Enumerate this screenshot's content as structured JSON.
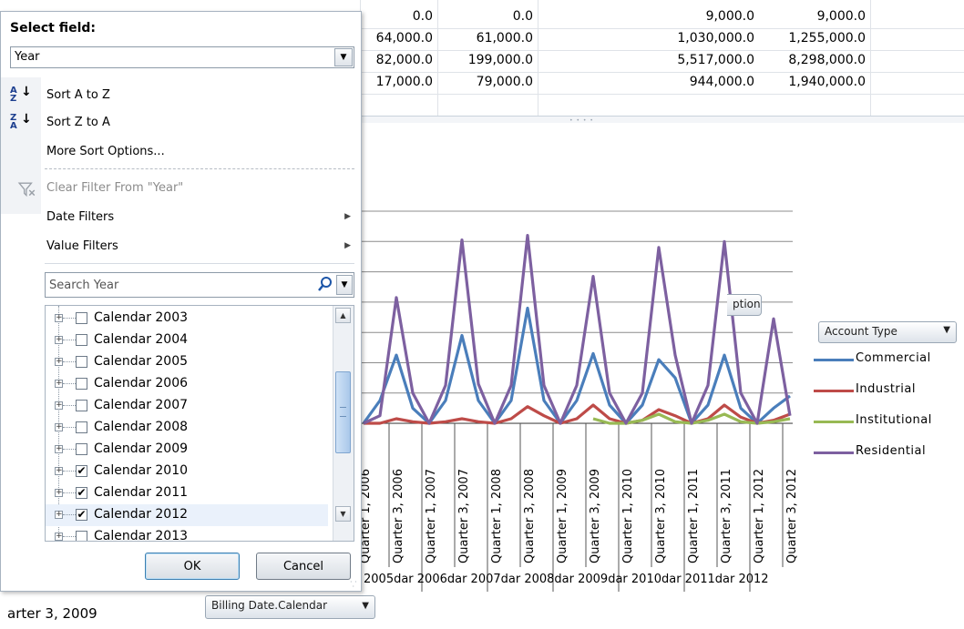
{
  "sheet": {
    "rows": [
      [
        "0.0",
        "0.0",
        "9,000.0",
        "9,000.0"
      ],
      [
        "64,000.0",
        "61,000.0",
        "1,030,000.0",
        "1,255,000.0"
      ],
      [
        "82,000.0",
        "199,000.0",
        "5,517,000.0",
        "8,298,000.0"
      ],
      [
        "17,000.0",
        "79,000.0",
        "944,000.0",
        "1,940,000.0"
      ]
    ],
    "bottom_cell": "arter 3, 2009"
  },
  "filter_panel": {
    "select_label": "Select field:",
    "field_value": "Year",
    "menu": {
      "sort_az": "Sort A to Z",
      "sort_za": "Sort Z to A",
      "more_sort": "More Sort Options...",
      "clear_filter": "Clear Filter From \"Year\"",
      "date_filters": "Date Filters",
      "value_filters": "Value Filters"
    },
    "search_placeholder": "Search Year",
    "tree_items": [
      {
        "label": "Calendar 2003",
        "checked": false
      },
      {
        "label": "Calendar 2004",
        "checked": false
      },
      {
        "label": "Calendar 2005",
        "checked": false
      },
      {
        "label": "Calendar 2006",
        "checked": false
      },
      {
        "label": "Calendar 2007",
        "checked": false
      },
      {
        "label": "Calendar 2008",
        "checked": false
      },
      {
        "label": "Calendar 2009",
        "checked": false
      },
      {
        "label": "Calendar 2010",
        "checked": true
      },
      {
        "label": "Calendar 2011",
        "checked": true
      },
      {
        "label": "Calendar 2012",
        "checked": true
      },
      {
        "label": "Calendar 2013",
        "checked": false
      }
    ],
    "ok_label": "OK",
    "cancel_label": "Cancel"
  },
  "chart": {
    "partial_button": "ption",
    "legend_field_label": "Account Type",
    "axis_field_label": "Billing Date.Calendar",
    "year_axis_text": "2005dar 2006dar 2007dar 2008dar 2009dar 2010dar 2011dar 2012",
    "colors": {
      "Commercial": "#4a7ebb",
      "Industrial": "#be4b48",
      "Institutional": "#98b954",
      "Residential": "#7d60a0"
    }
  },
  "chart_data": {
    "type": "line",
    "categories": [
      "Quarter 1, 2006",
      "Quarter 2, 2006",
      "Quarter 3, 2006",
      "Quarter 4, 2006",
      "Quarter 1, 2007",
      "Quarter 2, 2007",
      "Quarter 3, 2007",
      "Quarter 4, 2007",
      "Quarter 1, 2008",
      "Quarter 2, 2008",
      "Quarter 3, 2008",
      "Quarter 4, 2008",
      "Quarter 1, 2009",
      "Quarter 2, 2009",
      "Quarter 3, 2009",
      "Quarter 4, 2009",
      "Quarter 1, 2010",
      "Quarter 2, 2010",
      "Quarter 3, 2010",
      "Quarter 4, 2010",
      "Quarter 1, 2011",
      "Quarter 2, 2011",
      "Quarter 3, 2011",
      "Quarter 4, 2011",
      "Quarter 1, 2012",
      "Quarter 2, 2012",
      "Quarter 3, 2012"
    ],
    "visible_labels": [
      "Quarter 1, 2006",
      "Quarter 3, 2006",
      "Quarter 1, 2007",
      "Quarter 3, 2007",
      "Quarter 1, 2008",
      "Quarter 3, 2008",
      "Quarter 1, 2009",
      "Quarter 3, 2009",
      "Quarter 1, 2010",
      "Quarter 3, 2010",
      "Quarter 1, 2011",
      "Quarter 3, 2011",
      "Quarter 1, 2012",
      "Quarter 3, 2012"
    ],
    "series": [
      {
        "name": "Commercial",
        "values": [
          0,
          1.5,
          4.5,
          1.0,
          0,
          1.5,
          5.8,
          1.5,
          0,
          1.5,
          7.6,
          1.5,
          0,
          1.5,
          4.6,
          1.2,
          0,
          1.2,
          4.2,
          3.0,
          0,
          1.2,
          4.5,
          1.0,
          0,
          1.0,
          1.8
        ]
      },
      {
        "name": "Industrial",
        "values": [
          0,
          0,
          0.3,
          0.1,
          0,
          0.1,
          0.3,
          0.1,
          0,
          0.3,
          1.1,
          0.5,
          0,
          0.3,
          1.2,
          0.3,
          0,
          0.2,
          0.9,
          0.5,
          0,
          0.3,
          1.2,
          0.4,
          0,
          0.2,
          0.6
        ]
      },
      {
        "name": "Institutional",
        "values": [
          null,
          null,
          null,
          null,
          null,
          null,
          null,
          null,
          null,
          null,
          null,
          null,
          null,
          null,
          0.3,
          0,
          0,
          0.2,
          0.6,
          0.1,
          0,
          0.2,
          0.6,
          0.1,
          0,
          0.1,
          0.3
        ]
      },
      {
        "name": "Residential",
        "values": [
          0,
          0.5,
          8.3,
          2.0,
          0,
          2.5,
          12.1,
          2.6,
          0,
          2.5,
          12.4,
          2.5,
          0,
          2.5,
          9.7,
          2.0,
          0,
          2.0,
          11.6,
          4.5,
          0,
          2.5,
          12.0,
          2.0,
          0,
          6.9,
          0.5
        ]
      }
    ],
    "ylim": [
      0,
      14
    ],
    "grid": true,
    "legend_position": "right"
  }
}
